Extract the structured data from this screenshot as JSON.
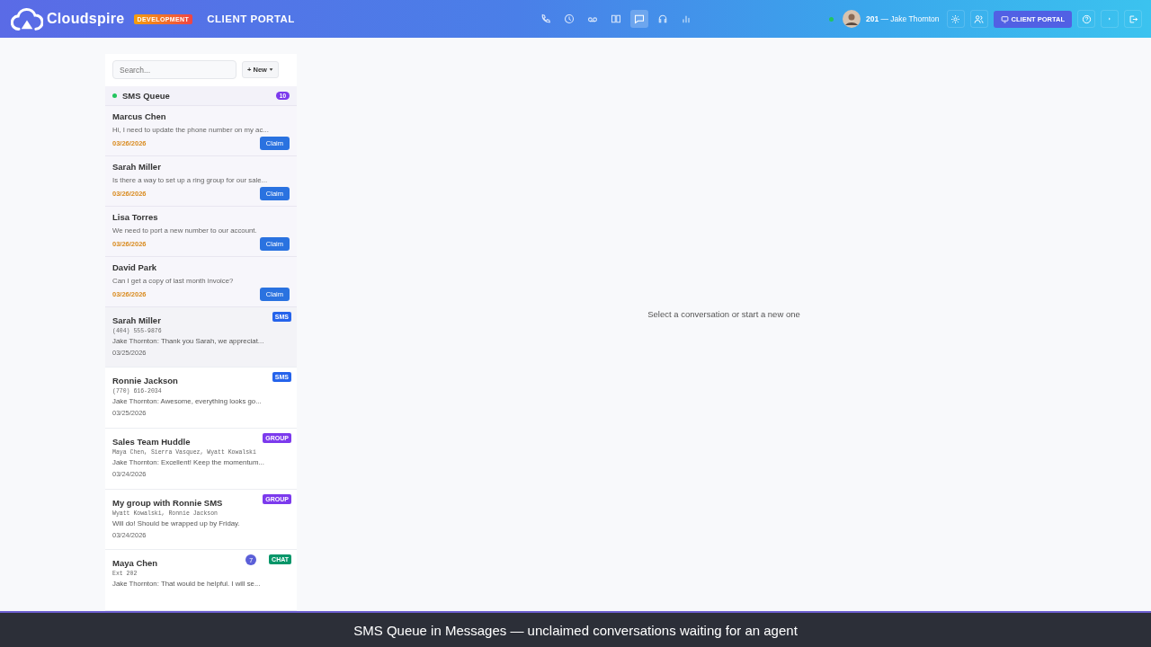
{
  "header": {
    "brand": "Cloudspire",
    "env_badge": "DEVELOPMENT",
    "portal_title": "CLIENT PORTAL",
    "nav": [
      {
        "kind": "phone",
        "selected": false
      },
      {
        "kind": "clock",
        "selected": false
      },
      {
        "kind": "voicemail",
        "selected": false
      },
      {
        "kind": "book",
        "selected": false
      },
      {
        "kind": "chat",
        "selected": true
      },
      {
        "kind": "headset",
        "selected": false
      },
      {
        "kind": "chart",
        "selected": false
      }
    ],
    "user": {
      "online": true,
      "extension": "201",
      "separator": "—",
      "name": "Jake Thornton"
    },
    "portal_button": "CLIENT PORTAL"
  },
  "sidebar": {
    "search": {
      "placeholder": "Search..."
    },
    "new_button": "+ New",
    "queue": {
      "title": "SMS Queue",
      "online": true,
      "count": "10",
      "items": [
        {
          "name": "Marcus Chen",
          "preview": "Hi, I need to update the phone number on my ac...",
          "date": "03/26/2026",
          "action": "Claim"
        },
        {
          "name": "Sarah Miller",
          "preview": "Is there a way to set up a ring group for our sale...",
          "date": "03/26/2026",
          "action": "Claim"
        },
        {
          "name": "Lisa Torres",
          "preview": "We need to port a new number to our account.",
          "date": "03/26/2026",
          "action": "Claim"
        },
        {
          "name": "David Park",
          "preview": "Can I get a copy of last month invoice?",
          "date": "03/26/2026",
          "action": "Claim"
        }
      ]
    },
    "conversations": [
      {
        "name": "Sarah Miller",
        "detail": "(404) 555-9876",
        "preview": "Jake Thornton: Thank you Sarah, we appreciat...",
        "date": "03/25/2026",
        "tag": {
          "label": "SMS",
          "color": "#2563eb"
        },
        "selected": true
      },
      {
        "name": "Ronnie Jackson",
        "detail": "(770) 616-2034",
        "preview": "Jake Thornton: Awesome, everything looks go...",
        "date": "03/25/2026",
        "tag": {
          "label": "SMS",
          "color": "#2563eb"
        },
        "selected": false
      },
      {
        "name": "Sales Team Huddle",
        "detail": "Maya Chen, Sierra Vasquez, Wyatt Kowalski",
        "preview": "Jake Thornton: Excellent! Keep the momentum...",
        "date": "03/24/2026",
        "tag": {
          "label": "GROUP",
          "color": "#7c3aed"
        },
        "selected": false
      },
      {
        "name": "My group with Ronnie SMS",
        "detail": "Wyatt Kowalski, Ronnie Jackson",
        "preview": "Will do! Should be wrapped up by Friday.",
        "date": "03/24/2026",
        "tag": {
          "label": "GROUP",
          "color": "#7c3aed"
        },
        "selected": false
      },
      {
        "name": "Maya Chen",
        "detail": "Ext 202",
        "preview": "Jake Thornton: That would be helpful. I will se...",
        "unread": "7",
        "tag": {
          "label": "CHAT",
          "color": "#059669"
        },
        "selected": false
      }
    ]
  },
  "empty_state": "Select a conversation or start a new one",
  "caption": "SMS Queue in Messages — unclaimed conversations waiting for an agent"
}
